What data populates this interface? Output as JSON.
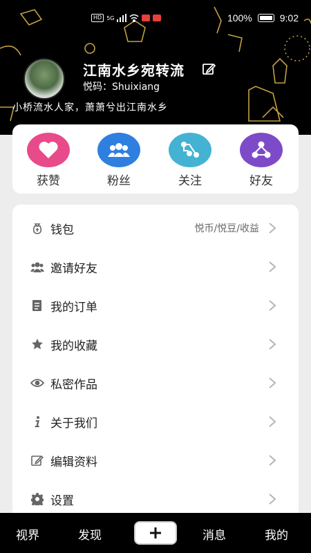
{
  "status_bar": {
    "hd": "HD",
    "network": "5G",
    "battery": "100%",
    "time": "9:02"
  },
  "profile": {
    "username": "江南水乡宛转流",
    "yuema": "悦码：Shuixiang",
    "signature": "小桥流水人家，萧萧兮出江南水乡"
  },
  "stats": [
    {
      "label": "获赞",
      "color": "#e84b8a",
      "icon": "heart-icon"
    },
    {
      "label": "粉丝",
      "color": "#2f7fe0",
      "icon": "users-icon"
    },
    {
      "label": "关注",
      "color": "#44b3d3",
      "icon": "share-icon"
    },
    {
      "label": "好友",
      "color": "#7d4bc8",
      "icon": "friends-icon"
    }
  ],
  "menu": [
    {
      "label": "钱包",
      "extra": "悦币/悦豆/收益",
      "icon": "wallet-icon"
    },
    {
      "label": "邀请好友",
      "extra": "",
      "icon": "invite-icon"
    },
    {
      "label": "我的订单",
      "extra": "",
      "icon": "order-icon"
    },
    {
      "label": "我的收藏",
      "extra": "",
      "icon": "star-icon"
    },
    {
      "label": "私密作品",
      "extra": "",
      "icon": "eye-icon"
    },
    {
      "label": "关于我们",
      "extra": "",
      "icon": "info-icon"
    },
    {
      "label": "编辑资料",
      "extra": "",
      "icon": "edit-icon"
    },
    {
      "label": "设置",
      "extra": "",
      "icon": "gear-icon"
    }
  ],
  "tabbar": {
    "tab1": "视界",
    "tab2": "发现",
    "tab4": "消息",
    "tab5": "我的"
  }
}
